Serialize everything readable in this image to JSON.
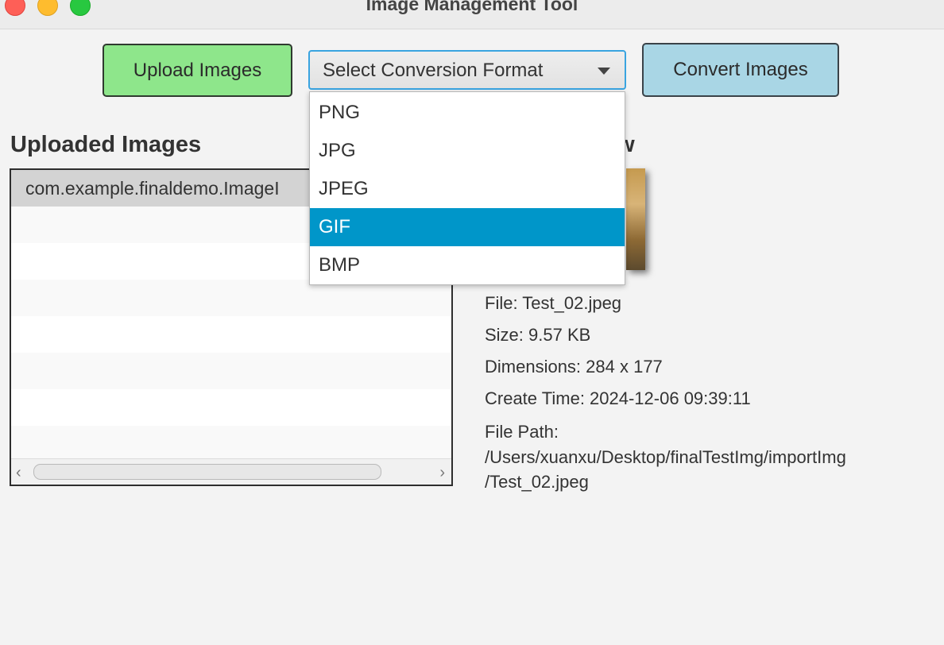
{
  "window": {
    "title": "Image Management Tool"
  },
  "toolbar": {
    "upload_label": "Upload Images",
    "format_select": {
      "label": "Select Conversion Format"
    },
    "convert_label": "Convert Images"
  },
  "format_options": [
    {
      "label": "PNG",
      "selected": false
    },
    {
      "label": "JPG",
      "selected": false
    },
    {
      "label": "JPEG",
      "selected": false
    },
    {
      "label": "GIF",
      "selected": true
    },
    {
      "label": "BMP",
      "selected": false
    }
  ],
  "uploaded": {
    "heading": "Uploaded Images",
    "items": [
      "com.example.finaldemo.ImageI"
    ]
  },
  "preview": {
    "heading_visible": "ew",
    "file": "File: Test_02.jpeg",
    "size": "Size: 9.57 KB",
    "dimensions": "Dimensions: 284 x 177",
    "create_time": "Create Time: 2024-12-06 09:39:11",
    "path_label": "File Path:",
    "path_line1": "/Users/xuanxu/Desktop/finalTestImg/importImg",
    "path_line2": "/Test_02.jpeg"
  },
  "colors": {
    "upload_button": "#8ee68b",
    "convert_button": "#a9d6e5",
    "menu_highlight": "#0096c9",
    "focus_ring": "#39a4e0"
  }
}
